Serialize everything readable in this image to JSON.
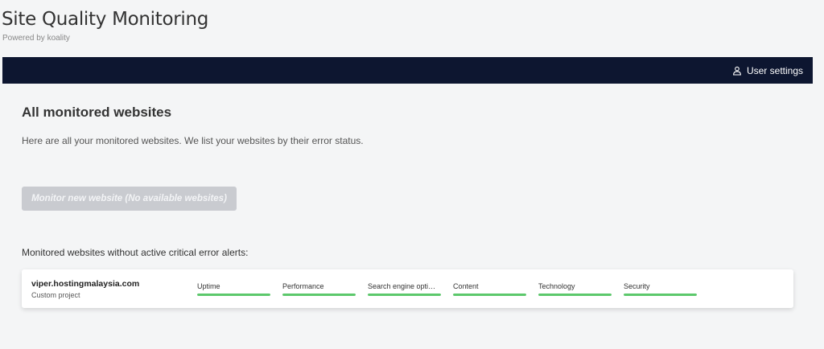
{
  "app": {
    "title": "Site Quality Monitoring",
    "subtitle": "Powered by koality"
  },
  "navbar": {
    "user_settings_label": "User settings",
    "user_icon": "user-icon",
    "background": "#0d1630"
  },
  "main": {
    "title": "All monitored websites",
    "description": "Here are all your monitored websites. We list your websites by their error status.",
    "monitor_button_label": "Monitor new website (No available websites)",
    "monitor_button_disabled": true,
    "section_label": "Monitored websites without active critical error alerts:"
  },
  "sites": [
    {
      "name": "viper.hostingmalaysia.com",
      "type": "Custom project",
      "metrics": [
        {
          "label": "Uptime",
          "progress": 1.0
        },
        {
          "label": "Performance",
          "progress": 1.0
        },
        {
          "label": "Search engine optimization",
          "progress": 1.0
        },
        {
          "label": "Content",
          "progress": 1.0
        },
        {
          "label": "Technology",
          "progress": 1.0
        },
        {
          "label": "Security",
          "progress": 1.0
        }
      ]
    }
  ],
  "colors": {
    "status_ok": "#5cc86b",
    "button_disabled": "#c9cbd0"
  }
}
